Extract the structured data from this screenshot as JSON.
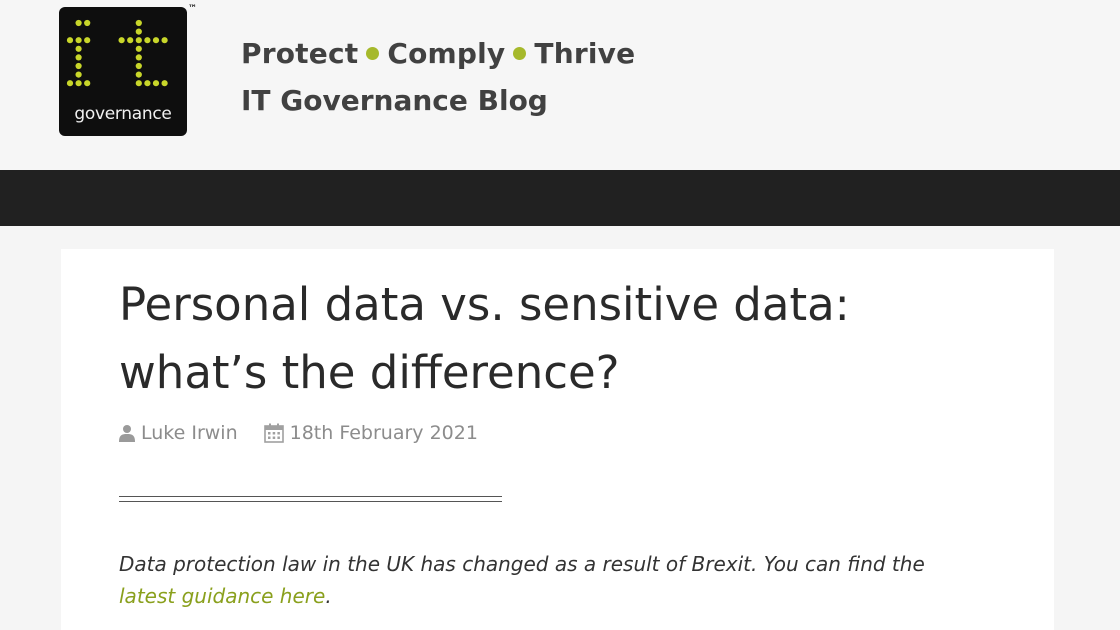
{
  "header": {
    "logo": {
      "word": "it",
      "subtext": "governance",
      "trademark": "™"
    },
    "tagline": [
      "Protect",
      "Comply",
      "Thrive"
    ],
    "blog_title": "IT Governance Blog"
  },
  "post": {
    "title_line1": "Personal data vs. sensitive data:",
    "title_line2": "what’s the difference?",
    "author": "Luke Irwin",
    "date": "18th February 2021",
    "intro_text": "Data protection law in the UK has changed as a result of Brexit. You can find the",
    "intro_link": "latest guidance here",
    "intro_end": "."
  },
  "colors": {
    "accent": "#a6b92b",
    "link": "#8aa01d",
    "navbar": "#212121",
    "logo_bg": "#0e0e0e"
  }
}
